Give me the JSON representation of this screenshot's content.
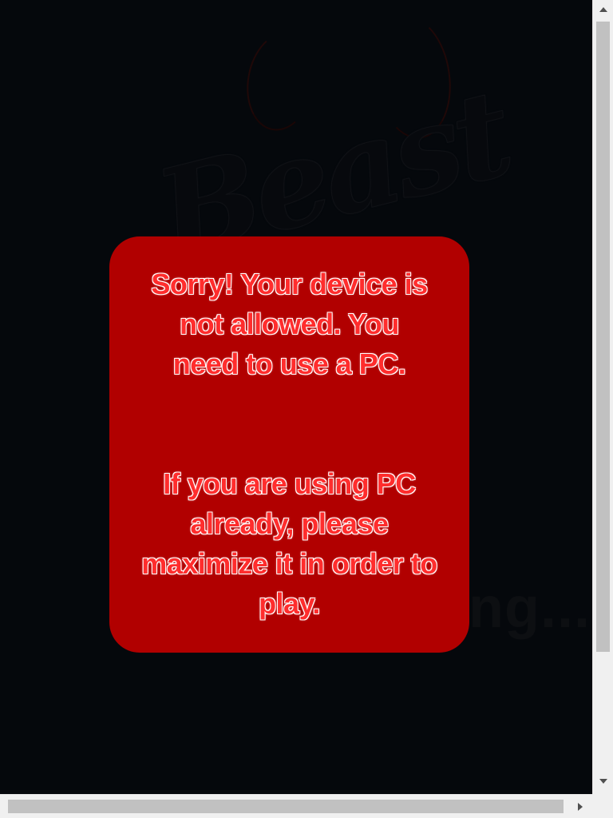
{
  "background": {
    "logo_text": "Beast",
    "loading_text": "Loading..."
  },
  "dialog": {
    "message_line1": "Sorry! Your device is not allowed. You need to use a PC.",
    "message_line2": "If you are using PC already, please maximize it in order to play.",
    "background_color": "#b10000",
    "text_color": "#ff2d2d"
  },
  "scrollbars": {
    "vertical": "visible",
    "horizontal": "visible"
  }
}
